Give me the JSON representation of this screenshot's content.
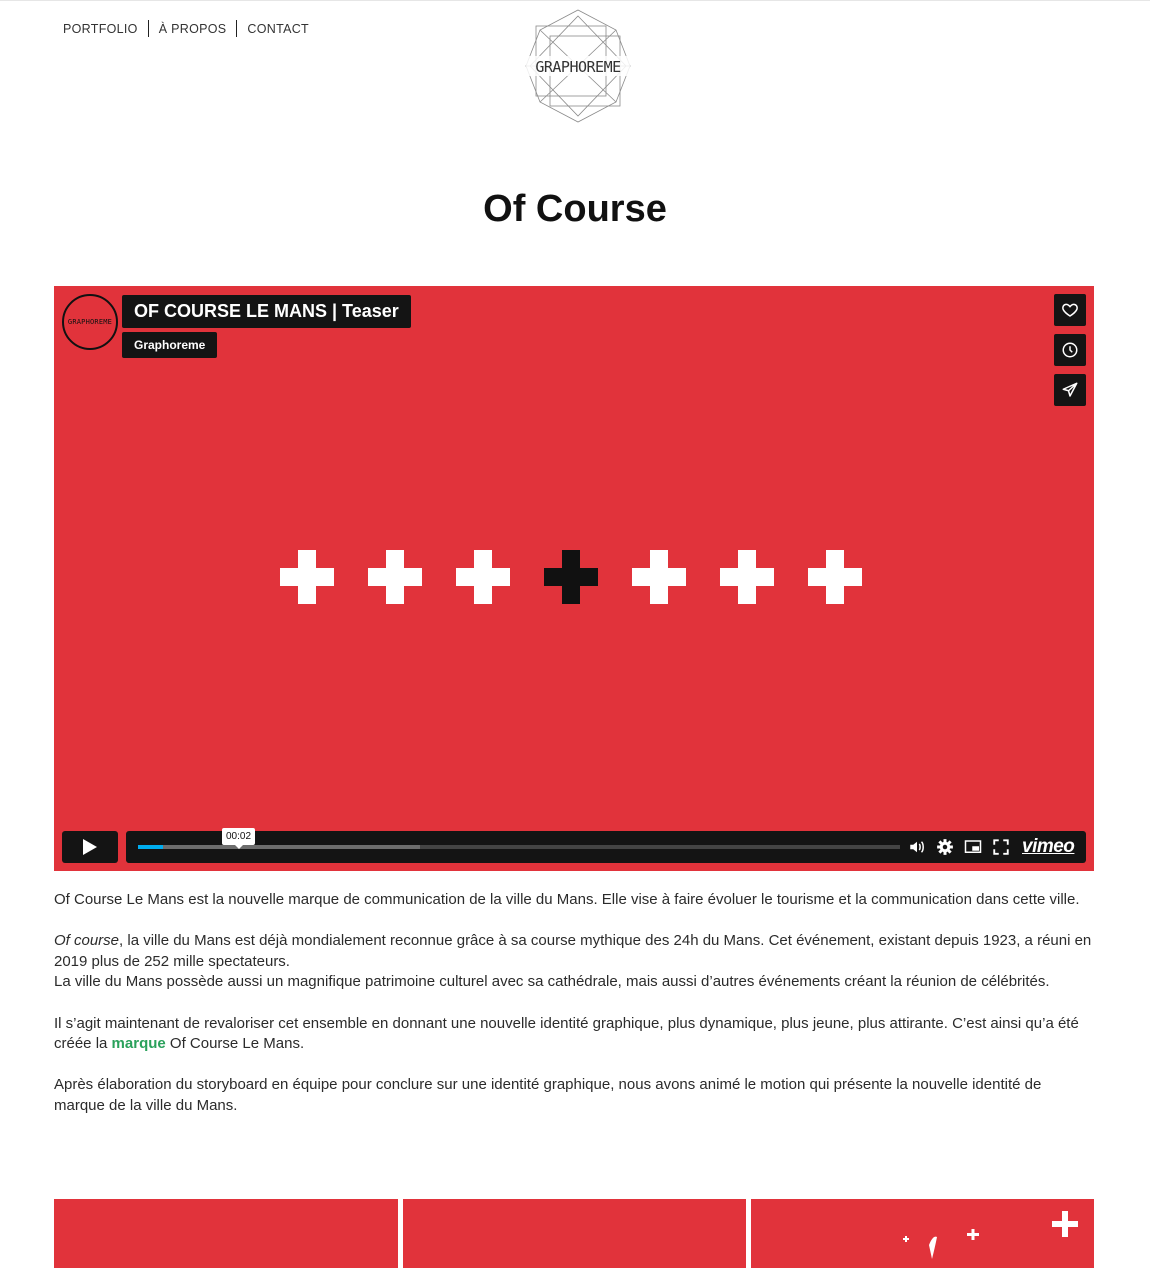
{
  "nav": {
    "items": [
      "PORTFOLIO",
      "À PROPOS",
      "CONTACT"
    ]
  },
  "logo": {
    "text": "GRAPHOREME"
  },
  "page": {
    "title": "Of Course"
  },
  "video": {
    "title": "OF COURSE LE MANS | Teaser",
    "owner": "Graphoreme",
    "avatar_text": "GRAPHOREME",
    "timecode": "00:02",
    "progress_played": 0.033,
    "progress_buffered": 0.37,
    "brand": "vimeo",
    "background_color": "#e1333b",
    "crosses": {
      "count": 7,
      "highlighted_index": 3
    },
    "side_buttons": [
      "heart-icon",
      "clock-icon",
      "send-icon"
    ],
    "controls": [
      "play-icon",
      "volume-icon",
      "settings-icon",
      "pip-icon",
      "fullscreen-icon"
    ]
  },
  "article": {
    "p1": "Of Course Le Mans est la nouvelle marque de communication de la ville du Mans. Elle vise à faire évoluer le tourisme et la communication dans cette ville.",
    "p2_italic": "Of course",
    "p2_rest": ", la ville du Mans est déjà mondialement reconnue grâce à sa course mythique des 24h du Mans. Cet événement, existant depuis 1923, a réuni en 2019 plus de 252 mille spectateurs.",
    "p2_line2": "La ville du Mans possède aussi un magnifique patrimoine culturel avec sa cathédrale, mais aussi d’autres événements créant la réunion de célébrités.",
    "p3_before": "Il s’agit maintenant de revaloriser cet ensemble en donnant une nouvelle identité graphique, plus dynamique, plus jeune, plus attirante. C’est ainsi qu’a été créée la ",
    "p3_link": "marque",
    "p3_after": " Of Course Le Mans.",
    "p4": "Après élaboration du storyboard en équipe pour conclure sur une identité graphique, nous avons animé le motion qui présente la nouvelle identité de marque de la ville du Mans.",
    "link_color": "#2aa15b"
  },
  "gallery": {
    "tiles": 3,
    "color": "#e1333b"
  }
}
